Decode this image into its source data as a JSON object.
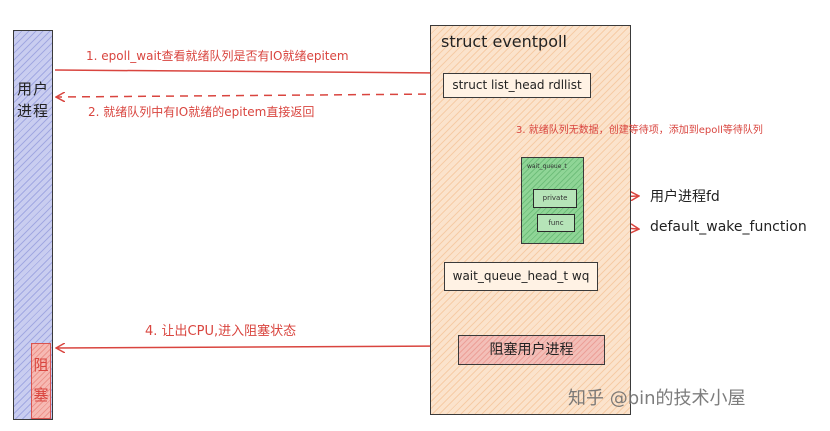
{
  "user_process": {
    "label": "用户进程",
    "blocked_label": "阻塞"
  },
  "eventpoll": {
    "title": "struct eventpoll",
    "rdllist": "struct list_head rdllist",
    "wait_queue_head": "wait_queue_head_t wq",
    "wait_queue_t": {
      "label": "wait_queue_t",
      "private": "private",
      "func": "func"
    },
    "blocked_process": "阻塞用户进程"
  },
  "steps": {
    "step1": "1. epoll_wait查看就绪队列是否有IO就绪epitem",
    "step2": "2. 就绪队列中有IO就绪的epitem直接返回",
    "step3": "3. 就绪队列无数据，创建等待项，添加到epoll等待队列",
    "step4": "4. 让出CPU,进入阻塞状态"
  },
  "callouts": {
    "private_target": "用户进程fd",
    "func_target": "default_wake_function"
  },
  "watermark": "知乎 @bin的技术小屋",
  "colors": {
    "arrow": "#d9453f",
    "user_bar": "#c9cdf0",
    "eventpoll_fill": "#fbe3cc",
    "wait_queue_fill": "#8fd596",
    "blocked_fill": "#f3bfb8"
  }
}
